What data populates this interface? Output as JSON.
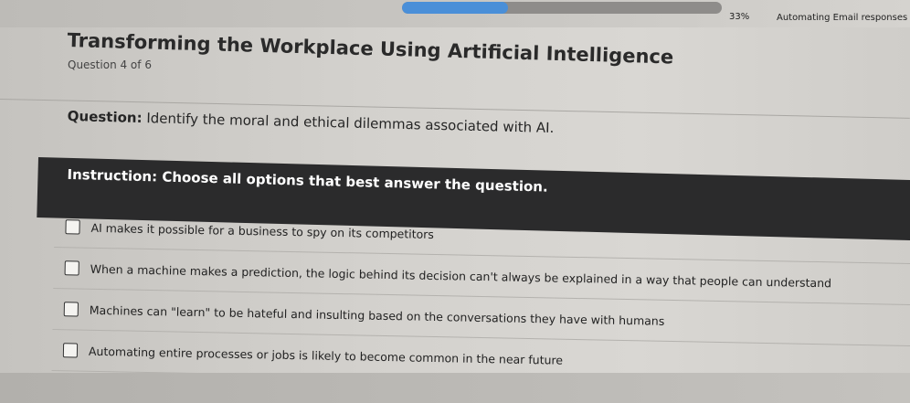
{
  "header": {
    "progress_percent": 33,
    "progress_label": "33%",
    "next_topic": "Automating Email responses wit"
  },
  "course": {
    "title": "Transforming the Workplace Using Artificial Intelligence",
    "question_number": "Question 4 of 6"
  },
  "question": {
    "prefix": "Question:",
    "text": " Identify the moral and ethical dilemmas associated with AI."
  },
  "instruction": {
    "text": "Instruction: Choose all options that best answer the question."
  },
  "options": [
    {
      "label": "AI makes it possible for a business to spy on its competitors",
      "checked": false
    },
    {
      "label": "When a machine makes a prediction, the logic behind its decision can't always be explained in a way that people can understand",
      "checked": false
    },
    {
      "label": "Machines can \"learn\" to be hateful and insulting based on the conversations they have with humans",
      "checked": false
    },
    {
      "label": "Automating entire processes or jobs is likely to become common in the near future",
      "checked": false
    }
  ],
  "colors": {
    "progress_fill": "#4a8fd8",
    "instruction_bg": "#2b2b2c"
  }
}
